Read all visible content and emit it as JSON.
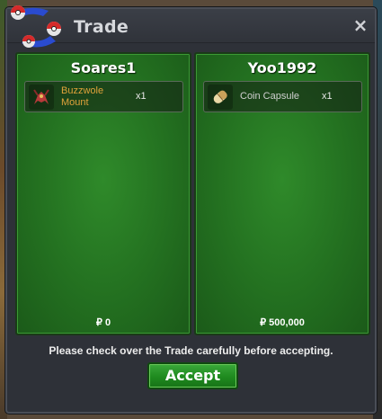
{
  "window": {
    "title": "Trade",
    "close_label": "×"
  },
  "trade": {
    "left": {
      "player": "Soares1",
      "items": [
        {
          "name": "Buzzwole Mount",
          "quantity": "x1",
          "icon": "buzzwole-mount-icon"
        }
      ],
      "money": "₽ 0"
    },
    "right": {
      "player": "Yoo1992",
      "items": [
        {
          "name": "Coin Capsule",
          "quantity": "x1",
          "icon": "coin-capsule-icon"
        }
      ],
      "money": "₽ 500,000"
    }
  },
  "footer": {
    "notice": "Please check over the Trade carefully before accepting.",
    "accept_label": "Accept"
  },
  "colors": {
    "panel_green": "#237020",
    "accept_green": "#1f8a1f",
    "item_orange": "#e0a23a",
    "window_bg": "#2e3138"
  }
}
